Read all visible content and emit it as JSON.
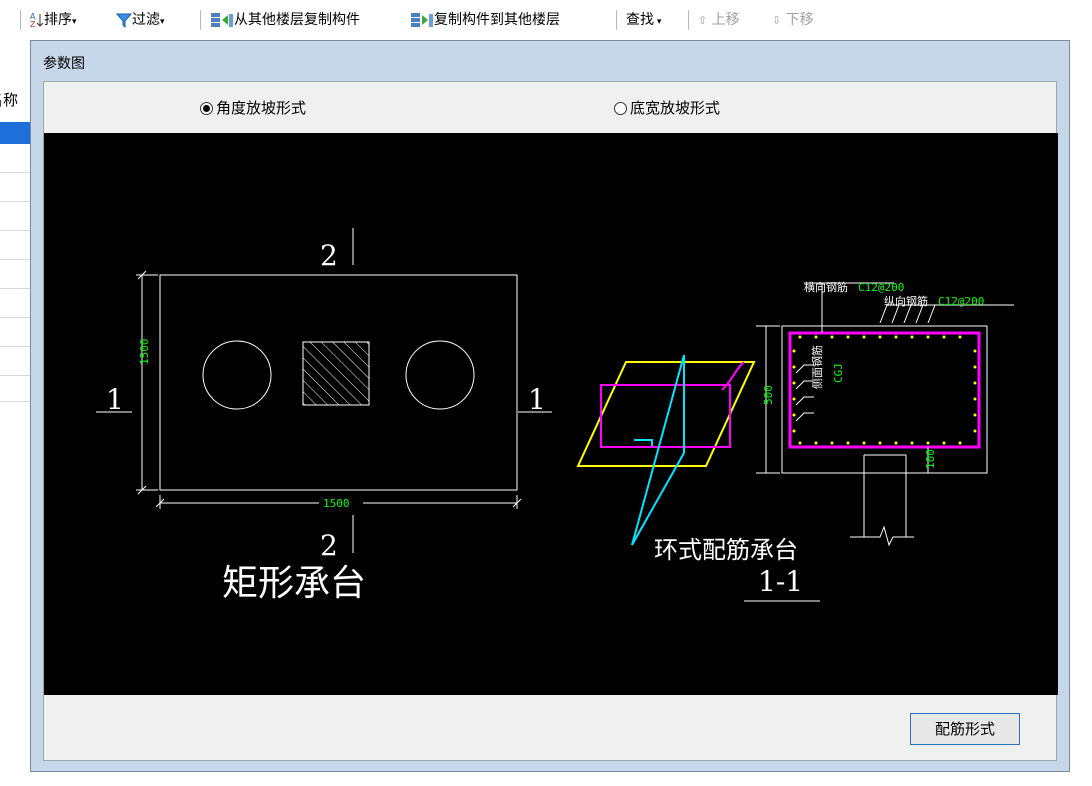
{
  "toolbar": {
    "sort_label": "排序",
    "filter_label": "过滤",
    "copy_from_label": "从其他楼层复制构件",
    "copy_to_label": "复制构件到其他楼层",
    "find_label": "查找",
    "move_up_label": "上移",
    "move_down_label": "下移"
  },
  "left_panel": {
    "header": "名称"
  },
  "dialog": {
    "title": "参数图",
    "radio_angle": "角度放坡形式",
    "radio_bottom_width": "底宽放坡形式",
    "selected": "radio_angle",
    "rebar_button": "配筋形式"
  },
  "drawing": {
    "section_label_2_top": "2",
    "section_label_2_bottom": "2",
    "section_label_1_left": "1",
    "section_label_1_right": "1",
    "dim_height": "1500",
    "dim_width": "1500",
    "plan_title": "矩形承台",
    "transverse_rebar_label": "横向钢筋",
    "transverse_rebar_value": "C12@200",
    "longitudinal_rebar_label": "纵向钢筋",
    "longitudinal_rebar_value": "C12@200",
    "side_rebar_label": "侧面钢筋",
    "side_rebar_code": "CGJ",
    "dim_section_height": "500",
    "dim_cover": "100",
    "section_title": "环式配筋承台",
    "section_name": "1-1",
    "colors": {
      "line": "#ffffff",
      "dim": "#00ff00",
      "magenta": "#ff00ff",
      "yellow": "#ffff00",
      "cyan": "#00e5ff"
    }
  }
}
